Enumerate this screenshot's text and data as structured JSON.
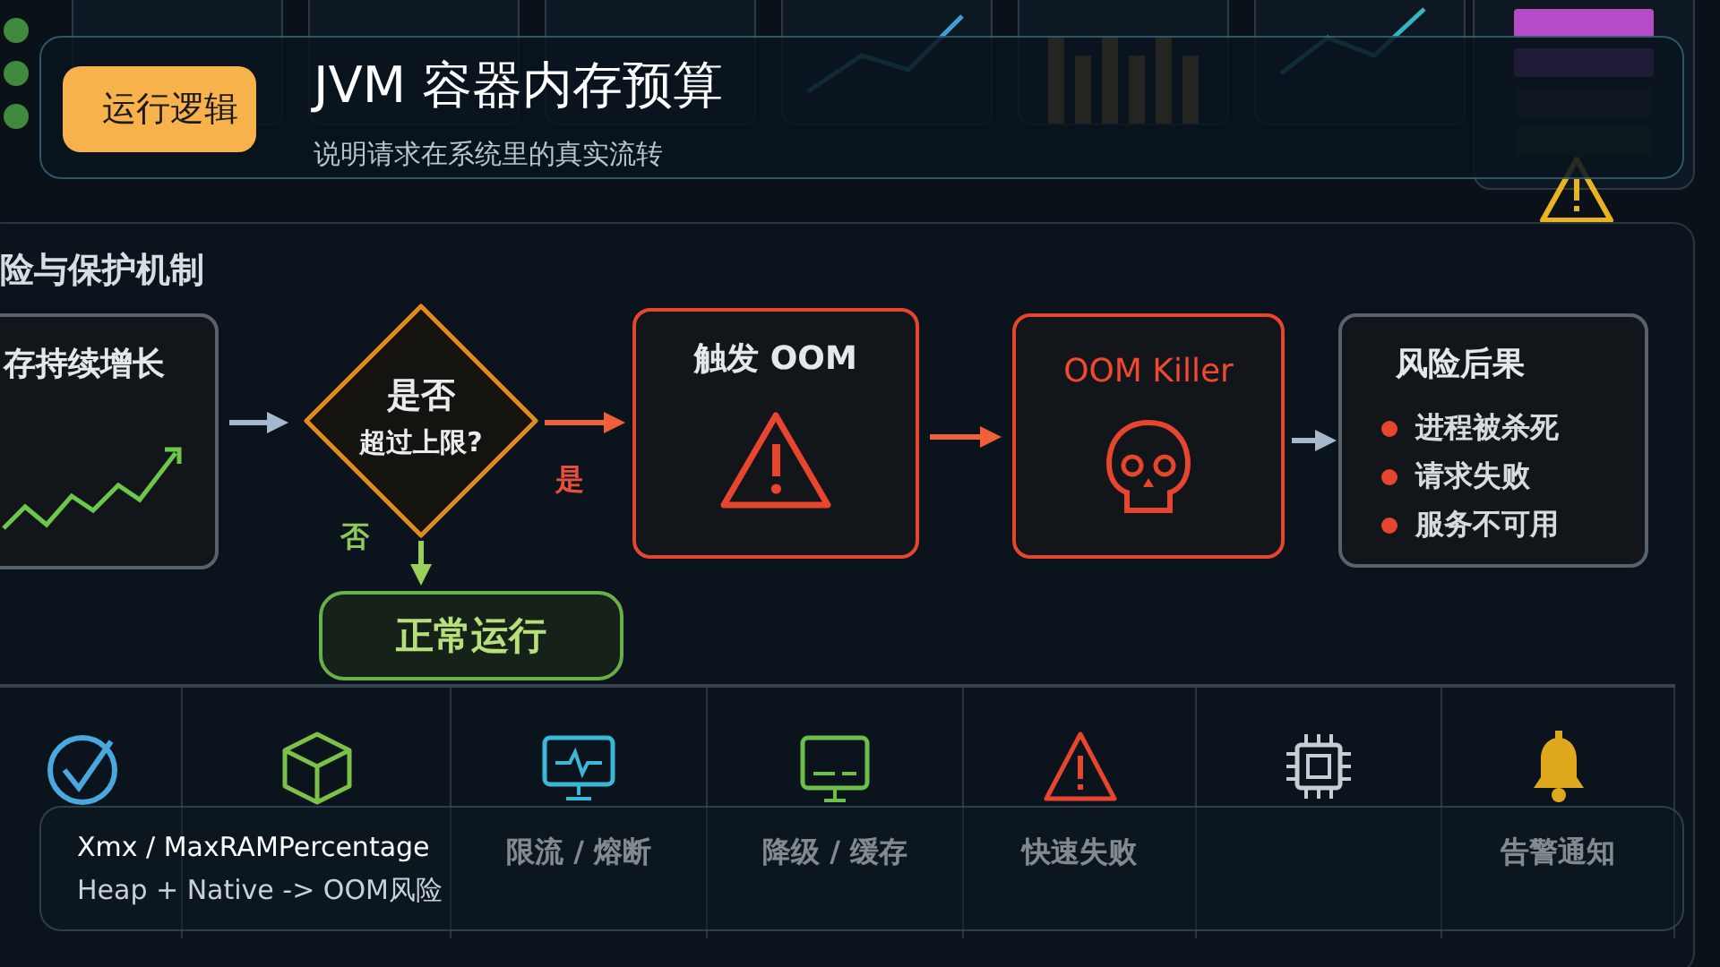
{
  "header": {
    "badge": "运行逻辑",
    "title": "JVM 容器内存预算",
    "subtitle": "说明请求在系统里的真实流转"
  },
  "diagram": {
    "section_title": "险与保护机制",
    "nodes": [
      {
        "kind": "chart",
        "label": "存持续增长"
      },
      {
        "kind": "decision",
        "lines": [
          "是否",
          "超过上限?"
        ]
      },
      {
        "kind": "alert",
        "label": "触发 OOM"
      },
      {
        "kind": "killer",
        "label": "OOM Killer"
      },
      {
        "kind": "list",
        "label": "风险后果",
        "items": [
          "进程被杀死",
          "请求失败",
          "服务不可用"
        ]
      }
    ],
    "yes_label": "是",
    "no_label": "否",
    "normal_label": "正常运行",
    "measures": [
      {
        "kind": "target"
      },
      {
        "kind": "cube"
      },
      {
        "kind": "monitor",
        "label": "限流 / 熔断"
      },
      {
        "kind": "screen",
        "label": "降级 / 缓存"
      },
      {
        "kind": "warning",
        "label": "快速失败"
      },
      {
        "kind": "chip"
      },
      {
        "kind": "bell",
        "label": "告警通知"
      }
    ]
  },
  "note": {
    "lines": [
      "Xmx / MaxRAMPercentage",
      "Heap + Native -> OOM风险"
    ]
  }
}
